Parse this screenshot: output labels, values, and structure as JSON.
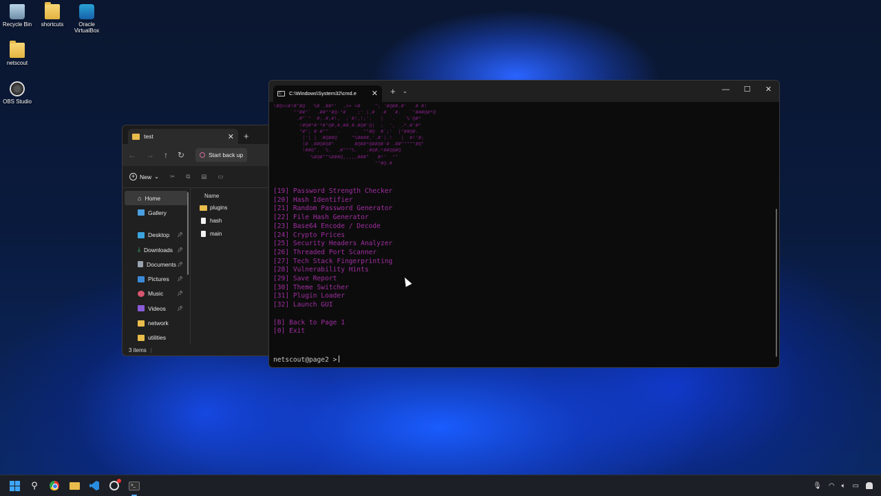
{
  "desktop": {
    "icons": [
      {
        "label": "Recycle Bin",
        "icon": "recycle-bin-icon"
      },
      {
        "label": "shortcuts",
        "icon": "folder-icon"
      },
      {
        "label": "Oracle VirtualBox",
        "icon": "virtualbox-icon"
      },
      {
        "label": "netscout",
        "icon": "folder-icon"
      },
      {
        "label": "OBS Studio",
        "icon": "obs-icon"
      }
    ]
  },
  "explorer": {
    "tab_title": "test",
    "backup_label": "Start back up",
    "new_label": "New",
    "sidebar": [
      {
        "label": "Home"
      },
      {
        "label": "Gallery"
      },
      {
        "label": "Desktop"
      },
      {
        "label": "Downloads"
      },
      {
        "label": "Documents"
      },
      {
        "label": "Pictures"
      },
      {
        "label": "Music"
      },
      {
        "label": "Videos"
      },
      {
        "label": "network"
      },
      {
        "label": "utilities"
      }
    ],
    "column_name": "Name",
    "files": [
      {
        "name": "plugins",
        "type": "folder"
      },
      {
        "name": "hash",
        "type": "file"
      },
      {
        "name": "main",
        "type": "file"
      }
    ],
    "status": "3 items"
  },
  "terminal": {
    "tab_title": "C:\\Windows\\System32\\cmd.e",
    "ascii_art": "!#@==#!#^#@  `%# .##*'  ,=+ =#    `\"; '#@##.#'   # #!\n      `\"\"##\"`  .##\"\"#@-\"#    ;' |.#  .#  `#.   `\"###@#*@\n        .#\"`\"  #;.#,#!,  ;`#!,!;'.   |  `.   `%'@#*\n         !#@#*#'*#\"@#,#,##.#.#@#'@|  ;  ',  .*.#'#*\n         \"#\"; # #\"\"`  .     .  \"\"#@  #`;'  |\"##@#.\n          |'| |  #@##@     \"%####,'.#'|.!   |  #!'#;\n          |# .##@#@#\"       #@##*@##@#'# .##\"\"\"\"\"#@\"\n          !##@\". `%.  .#\"\"\"%.   .#@#;*##@@#@\n            `%#@#\"\"%###@,,,,,###\"   #*'  \"\"\n                                   \"\"#@.#",
    "menu": [
      "[19] Password Strength Checker",
      "[20] Hash Identifier",
      "[21] Random Password Generator",
      "[22] File Hash Generator",
      "[23] Base64 Encode / Decode",
      "[24] Crypto Prices",
      "[25] Security Headers Analyzer",
      "[26] Threaded Port Scanner",
      "[27] Tech Stack Fingerprinting",
      "[28] Vulnerability Hints",
      "[29] Save Report",
      "[30] Theme Switcher",
      "[31] Plugin Loader",
      "[32] Launch GUI"
    ],
    "footer_menu": [
      "[B] Back to Page 1",
      "[0] Exit"
    ],
    "prompt": "netscout@page2 >",
    "menu_color": "#a12ea1"
  },
  "taskbar": {
    "apps": [
      "windows-start-icon",
      "search-icon",
      "chrome-icon",
      "file-explorer-icon",
      "vscode-icon",
      "obs-icon",
      "terminal-icon"
    ],
    "tray": [
      "microphone-icon",
      "wifi-icon",
      "volume-icon",
      "battery-icon",
      "notification-icon"
    ]
  }
}
